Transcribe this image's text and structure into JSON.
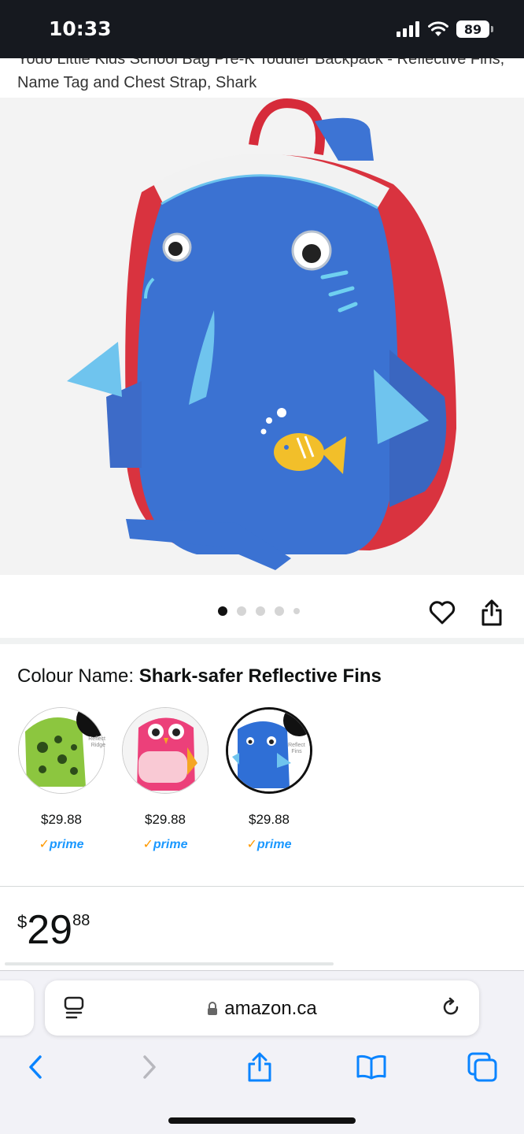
{
  "status": {
    "time": "10:33",
    "battery": "89"
  },
  "product": {
    "title": "Yodo Little Kids School Bag Pre-K Toddler Backpack - Reflective Fins, Name Tag and Chest Strap, Shark",
    "image_dots": 5,
    "active_image": 1,
    "colour_label": "Colour Name: ",
    "colour_value": "Shark-safer Reflective Fins",
    "price_symbol": "$",
    "price_whole": "29",
    "price_fraction": "88"
  },
  "swatches": [
    {
      "name": "Dinosaur",
      "badge": "Reflect Ridge",
      "price": "$29.88",
      "prime": "prime",
      "selected": false,
      "color": "#8cc63f"
    },
    {
      "name": "Owl",
      "badge": "",
      "price": "$29.88",
      "prime": "prime",
      "selected": false,
      "color": "#ec407a"
    },
    {
      "name": "Shark",
      "badge": "Reflect Fins",
      "price": "$29.88",
      "prime": "prime",
      "selected": true,
      "color": "#2f6fd6"
    }
  ],
  "browser": {
    "url": "amazon.ca"
  },
  "icons": {
    "wishlist": "heart-icon",
    "share": "share-icon",
    "tabs_overview": "tab-icon",
    "reload": "reload-icon",
    "back": "chevron-left-icon",
    "forward": "chevron-right-icon",
    "bookmarks": "book-icon",
    "tabs": "tabs-icon"
  },
  "colors": {
    "prime_blue": "#1a98ff",
    "prime_check": "#ff9900",
    "status_bar": "#16191f",
    "link_blue": "#0a84ff"
  }
}
